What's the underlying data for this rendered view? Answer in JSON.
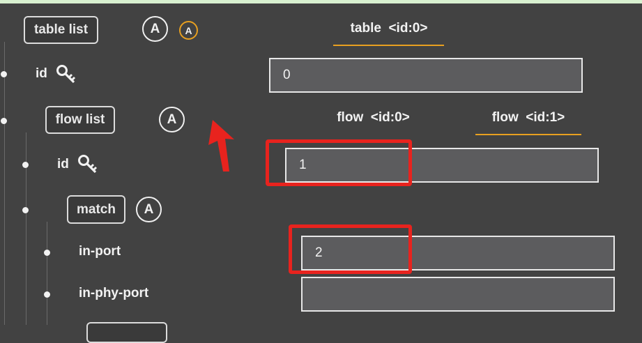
{
  "tree": {
    "table_list_label": "table list",
    "auto_badge": "A",
    "id_label": "id",
    "flow_list_label": "flow list",
    "flow_id_label": "id",
    "match_label": "match",
    "in_port_label": "in-port",
    "in_phy_port_label": "in-phy-port"
  },
  "tabs": {
    "table_tab": "table  <id:0>",
    "flow_tab_0": "flow  <id:0>",
    "flow_tab_1": "flow  <id:1>"
  },
  "fields": {
    "table_id_value": "0",
    "flow_id_value": "1",
    "in_port_value": "2",
    "in_phy_port_value": ""
  },
  "colors": {
    "background": "#424242",
    "tab_underline": "#e8a020",
    "annotation_red": "#e8231e",
    "badge_orange": "#e8a020"
  },
  "icons": [
    "key-icon",
    "key-icon",
    "auto-badge-icon",
    "red-arrow-annotation"
  ]
}
